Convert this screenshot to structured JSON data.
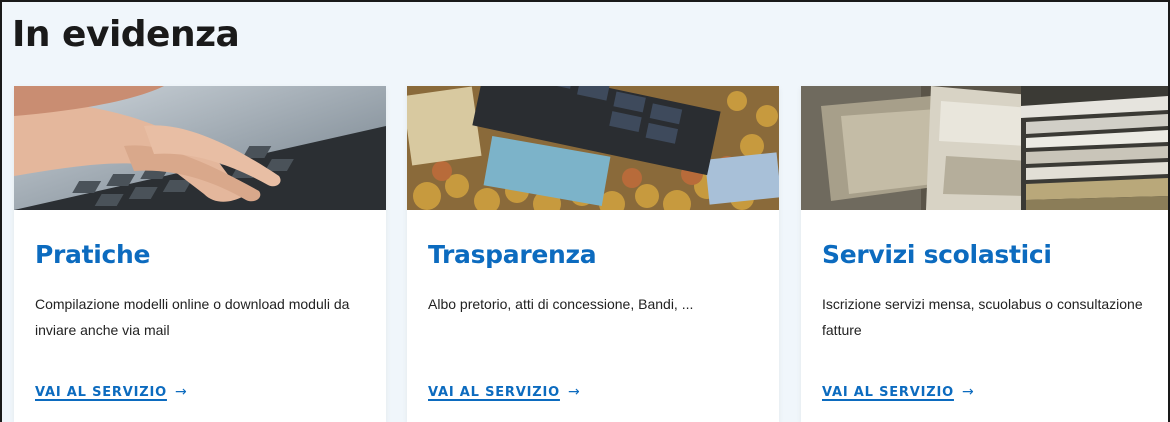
{
  "section": {
    "title": "In evidenza"
  },
  "cards": [
    {
      "title": "Pratiche",
      "description": "Compilazione modelli online o download moduli da inviare anche via mail",
      "link": "VAI AL SERVIZIO",
      "arrow": "→"
    },
    {
      "title": "Trasparenza",
      "description": "Albo pretorio, atti di concessione, Bandi, ...",
      "link": "VAI AL SERVIZIO",
      "arrow": "→"
    },
    {
      "title": "Servizi scolastici",
      "description": "Iscrizione servizi mensa, scuolabus o consultazione fatture",
      "link": "VAI AL SERVIZIO",
      "arrow": "→"
    }
  ],
  "colors": {
    "accent": "#0c6bbf",
    "background": "#f0f6fb"
  }
}
